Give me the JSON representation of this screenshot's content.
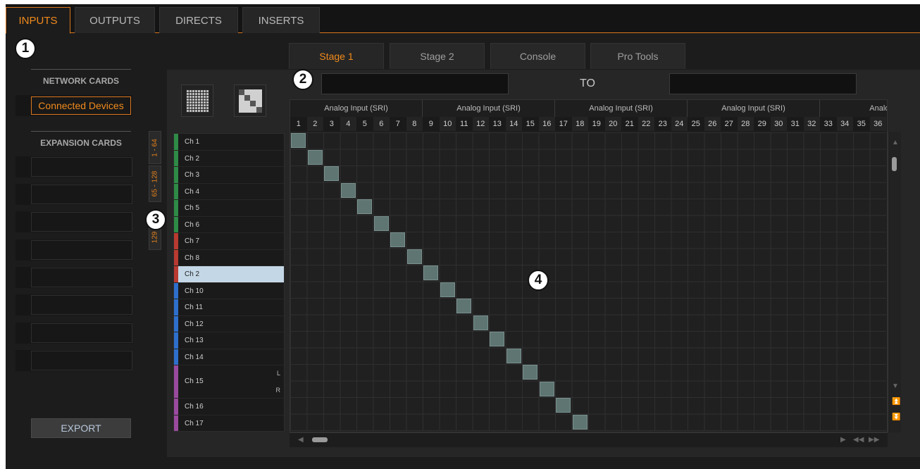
{
  "top_tabs": [
    "INPUTS",
    "OUTPUTS",
    "DIRECTS",
    "INSERTS"
  ],
  "active_top_tab": "INPUTS",
  "callouts": [
    "1",
    "2",
    "3",
    "4"
  ],
  "sidebar": {
    "network_title": "NETWORK CARDS",
    "connected_devices": "Connected Devices",
    "expansion_title": "EXPANSION CARDS",
    "export": "EXPORT"
  },
  "stage_tabs": [
    "Stage 1",
    "Stage 2",
    "Console",
    "Pro Tools"
  ],
  "active_stage_tab": "Stage 1",
  "routing": {
    "to_label": "TO"
  },
  "range_tabs": [
    "1 - 64",
    "65 - 128",
    "129"
  ],
  "channels": [
    {
      "label": "Ch 1",
      "color": "#2e8a46"
    },
    {
      "label": "Ch 2",
      "color": "#2e8a46"
    },
    {
      "label": "Ch 3",
      "color": "#2e8a46"
    },
    {
      "label": "Ch 4",
      "color": "#2e8a46"
    },
    {
      "label": "Ch 5",
      "color": "#2e8a46"
    },
    {
      "label": "Ch 6",
      "color": "#2e8a46"
    },
    {
      "label": "Ch 7",
      "color": "#b83a30"
    },
    {
      "label": "Ch 8",
      "color": "#b83a30"
    },
    {
      "label": "Ch 2",
      "color": "#b83a30",
      "selected": true
    },
    {
      "label": "Ch 10",
      "color": "#2e6fcc"
    },
    {
      "label": "Ch 11",
      "color": "#2e6fcc"
    },
    {
      "label": "Ch 12",
      "color": "#2e6fcc"
    },
    {
      "label": "Ch 13",
      "color": "#2e6fcc"
    },
    {
      "label": "Ch 14",
      "color": "#2e6fcc"
    },
    {
      "label": "Ch 15",
      "color": "#9a4a9e",
      "stereo": true,
      "left": "L",
      "right": "R"
    },
    {
      "label": "Ch 16",
      "color": "#9a4a9e"
    },
    {
      "label": "Ch 17",
      "color": "#9a4a9e"
    }
  ],
  "matrix": {
    "groups": [
      "Analog Input (SRI)",
      "Analog Input (SRI)",
      "Analog Input (SRI)",
      "Analog Input (SRI)",
      "Analog In"
    ],
    "columns": [
      "1",
      "2",
      "3",
      "4",
      "5",
      "6",
      "7",
      "8",
      "9",
      "10",
      "11",
      "12",
      "13",
      "14",
      "15",
      "16",
      "17",
      "18",
      "19",
      "20",
      "21",
      "22",
      "23",
      "24",
      "25",
      "26",
      "27",
      "28",
      "29",
      "30",
      "31",
      "32",
      "33",
      "34",
      "35",
      "36"
    ],
    "routed_rows": 18
  },
  "colors": {
    "accent": "#f08a1c",
    "selected_row": "#c4d7e6",
    "node": "#5e7572"
  }
}
